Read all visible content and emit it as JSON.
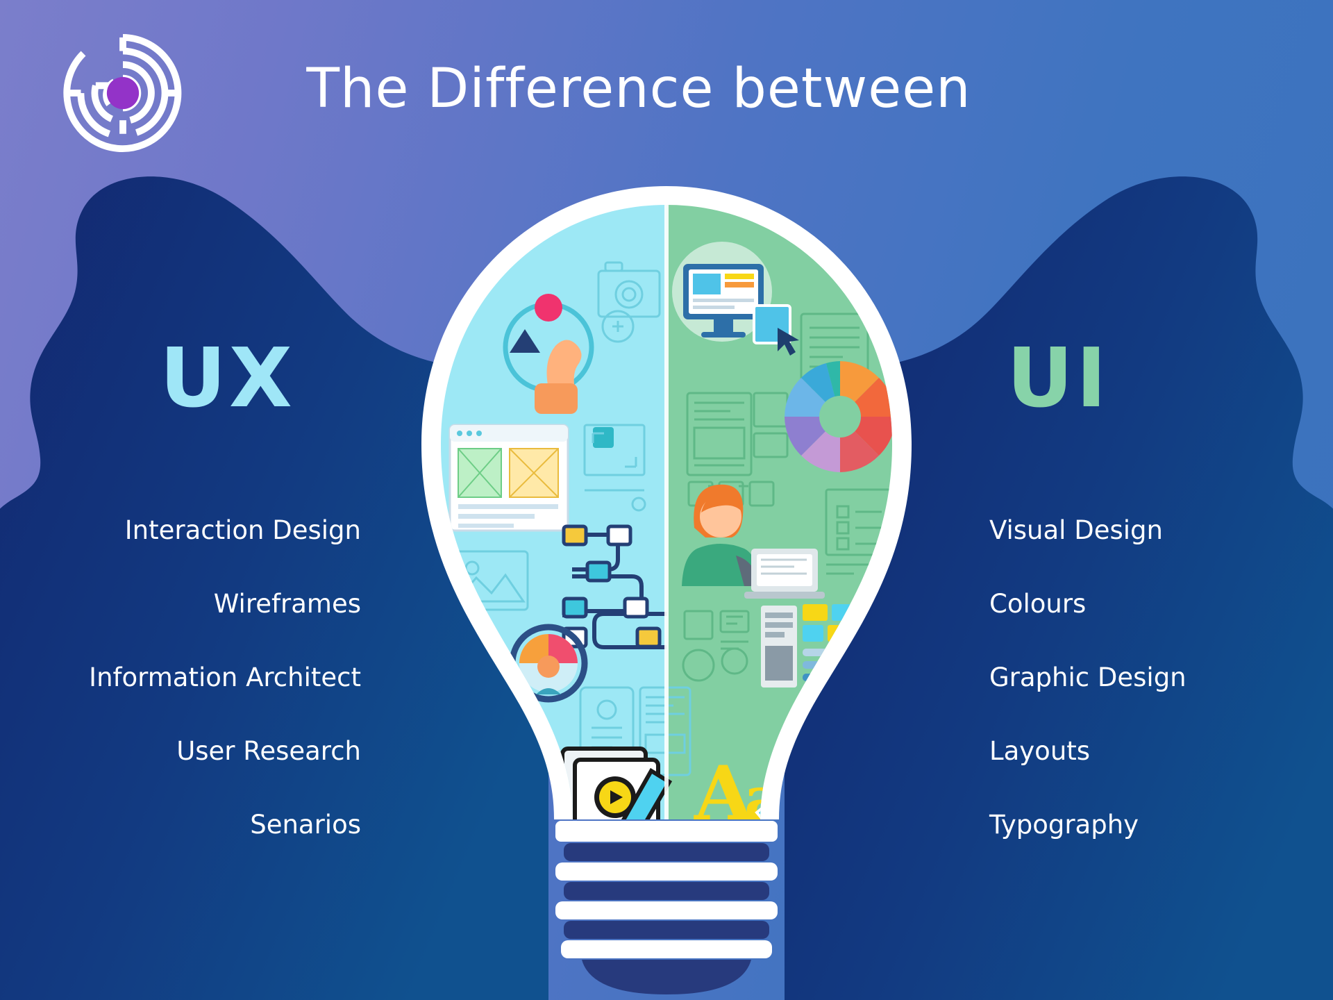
{
  "header": {
    "title": "The Difference between",
    "logo_icon": "maze-logo-icon"
  },
  "colors": {
    "bg_gradient_start": "#7b7ecb",
    "bg_gradient_end": "#3a72bd",
    "head_silhouette": "#13357f",
    "head_silhouette_right": "#0f4e8f",
    "ux_accent": "#9fe6f7",
    "ui_accent": "#87d3a9",
    "bulb_ux_fill": "#9de8f5",
    "bulb_ui_fill": "#82cfa2",
    "bulb_outline": "#ffffff",
    "bulb_base": "#273a7d",
    "logo_center": "#9333c8",
    "text": "#ffffff"
  },
  "ux": {
    "heading": "UX",
    "items": [
      "Interaction Design",
      "Wireframes",
      "Information Architect",
      "User Research",
      "Senarios"
    ]
  },
  "ui": {
    "heading": "UI",
    "items": [
      "Visual Design",
      "Colours",
      "Graphic Design",
      "Layouts",
      "Typography"
    ]
  },
  "bulb": {
    "ux_side_icons": [
      "camera-wireframe-icon",
      "cursor-target-icon",
      "browser-wireframe-icon",
      "crop-frame-icon",
      "image-placeholder-icon",
      "flowchart-icon",
      "user-search-icon",
      "mobile-wireframe-icon",
      "document-play-pencil-icon"
    ],
    "ui_side_icons": [
      "monitor-design-icon",
      "text-lines-icon",
      "layout-grid-icon",
      "color-wheel-icon",
      "designer-person-icon",
      "checklist-icon",
      "ui-components-icon",
      "typography-aa-icon",
      "pen-tool-icon"
    ]
  }
}
